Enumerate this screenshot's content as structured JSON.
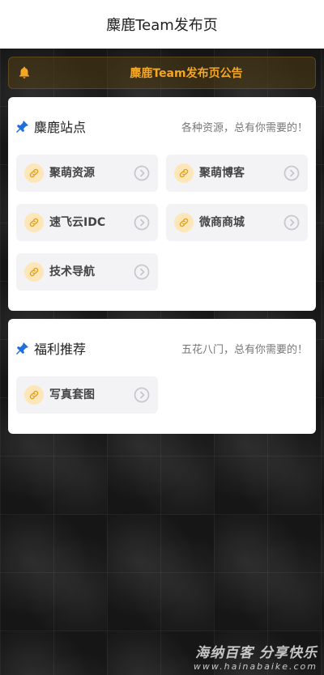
{
  "header": {
    "title": "麋鹿Team发布页"
  },
  "notice": {
    "text": "麋鹿Team发布页公告",
    "icon": "bell-icon",
    "color": "#f5a623"
  },
  "sections": [
    {
      "title": "麋鹿站点",
      "subtitle": "各种资源，总有你需要的！",
      "items": [
        "聚萌资源",
        "聚萌博客",
        "速飞云IDC",
        "微商商城",
        "技术导航"
      ]
    },
    {
      "title": "福利推荐",
      "subtitle": "五花八门，总有你需要的！",
      "items": [
        "写真套图"
      ]
    }
  ],
  "watermark": {
    "main": "海纳百客 分享快乐",
    "sub": "www.hainabaike.com"
  },
  "colors": {
    "accent": "#f5a623",
    "brand_icon": "#1e6fd9",
    "tile_bg": "#f3f3f5"
  }
}
